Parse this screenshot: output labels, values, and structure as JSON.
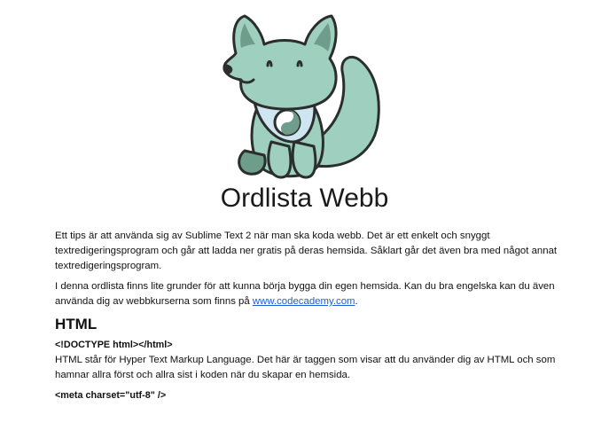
{
  "page": {
    "title": "Ordlista Webb"
  },
  "intro": {
    "p1": "Ett tips är att använda sig av Sublime Text 2 när man ska koda webb. Det är ett enkelt och snyggt textredigeringsprogram och går att ladda ner gratis på deras hemsida. Såklart går det även bra med något annat textredigeringsprogram.",
    "p2_text": "I denna ordlista finns lite grunder för att kunna börja bygga din egen hemsida. Kan du bra engelska kan du även använda dig av webbkurserna som finns på ",
    "p2_link": "www.codecademy.com",
    "p2_end": "."
  },
  "html_section": {
    "heading": "HTML",
    "terms": [
      {
        "term": "<!DOCTYPE html></html>",
        "description": "HTML står för Hyper Text Markup Language. Det här är taggen som visar att du använder dig av HTML och som hamnar allra först och allra sist i koden när du skapar en hemsida."
      },
      {
        "term": "<meta charset=\"utf-8\" />",
        "description": ""
      }
    ]
  },
  "colors": {
    "mascot_fill": "#9ecfbf",
    "mascot_dark": "#6f9d8c",
    "link": "#1a5fd6"
  },
  "icons": {
    "mascot": "fox-mascot-icon",
    "badge": "yin-yang-icon"
  }
}
